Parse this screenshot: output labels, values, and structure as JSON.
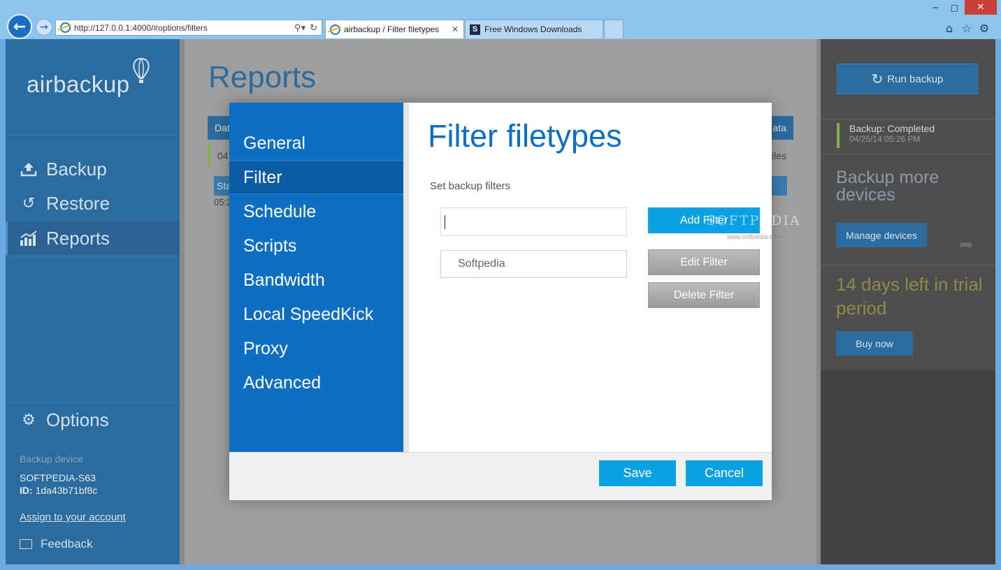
{
  "browser": {
    "address": "http://127.0.0.1:4000/#options/filters",
    "tabs": [
      {
        "label": "airbackup / Filter filetypes",
        "active": true
      },
      {
        "label": "Free Windows Downloads",
        "active": false
      }
    ],
    "accent": "#8dc4ee",
    "icons": [
      "back-arrow-icon",
      "forward-arrow-icon",
      "ie-icon",
      "search-icon",
      "refresh-icon",
      "home-icon",
      "star-icon",
      "gear-icon"
    ]
  },
  "sidebar": {
    "logo": "airbackup",
    "nav": [
      {
        "label": "Backup",
        "icon": "upload-icon"
      },
      {
        "label": "Restore",
        "icon": "history-icon"
      },
      {
        "label": "Reports",
        "icon": "chart-icon",
        "active": true
      }
    ],
    "options": {
      "label": "Options",
      "icon": "gear-icon"
    },
    "device_caption": "Backup device",
    "device_name": "SOFTPEDIA-S63",
    "device_id_label": "ID:",
    "device_id": "1da43b71bf8c",
    "assign_link": "Assign to your account",
    "feedback": "Feedback",
    "color": "#2c6b9e"
  },
  "main": {
    "title": "Reports",
    "table_header": {
      "left": "Dat",
      "right": "ata"
    },
    "row1": {
      "left": "04",
      "right": "iles"
    },
    "row2": {
      "left": "Sta"
    },
    "row3": {
      "left": "05:2"
    }
  },
  "right_panel": {
    "run_backup": "Run backup",
    "status_title": "Backup: Completed",
    "status_time": "04/25/14 05:26 PM",
    "backup_more": "Backup more devices",
    "manage_devices": "Manage devices",
    "trial": "14 days left in trial period",
    "buy_now": "Buy now"
  },
  "modal": {
    "nav": [
      {
        "label": "General"
      },
      {
        "label": "Filter",
        "active": true
      },
      {
        "label": "Schedule"
      },
      {
        "label": "Scripts"
      },
      {
        "label": "Bandwidth"
      },
      {
        "label": "Local SpeedKick"
      },
      {
        "label": "Proxy"
      },
      {
        "label": "Advanced"
      }
    ],
    "title": "Filter filetypes",
    "set_filters_label": "Set backup filters",
    "filter_input_value": "",
    "filters": [
      "Softpedia"
    ],
    "add_filter": "Add Filter",
    "edit_filter": "Edit Filter",
    "delete_filter": "Delete Filter",
    "save": "Save",
    "cancel": "Cancel",
    "accent": "#0c6fc3",
    "button_color": "#0aa0e4"
  },
  "watermark": {
    "text": "SOFTPEDIA",
    "sub": "www.softpedia.com"
  }
}
